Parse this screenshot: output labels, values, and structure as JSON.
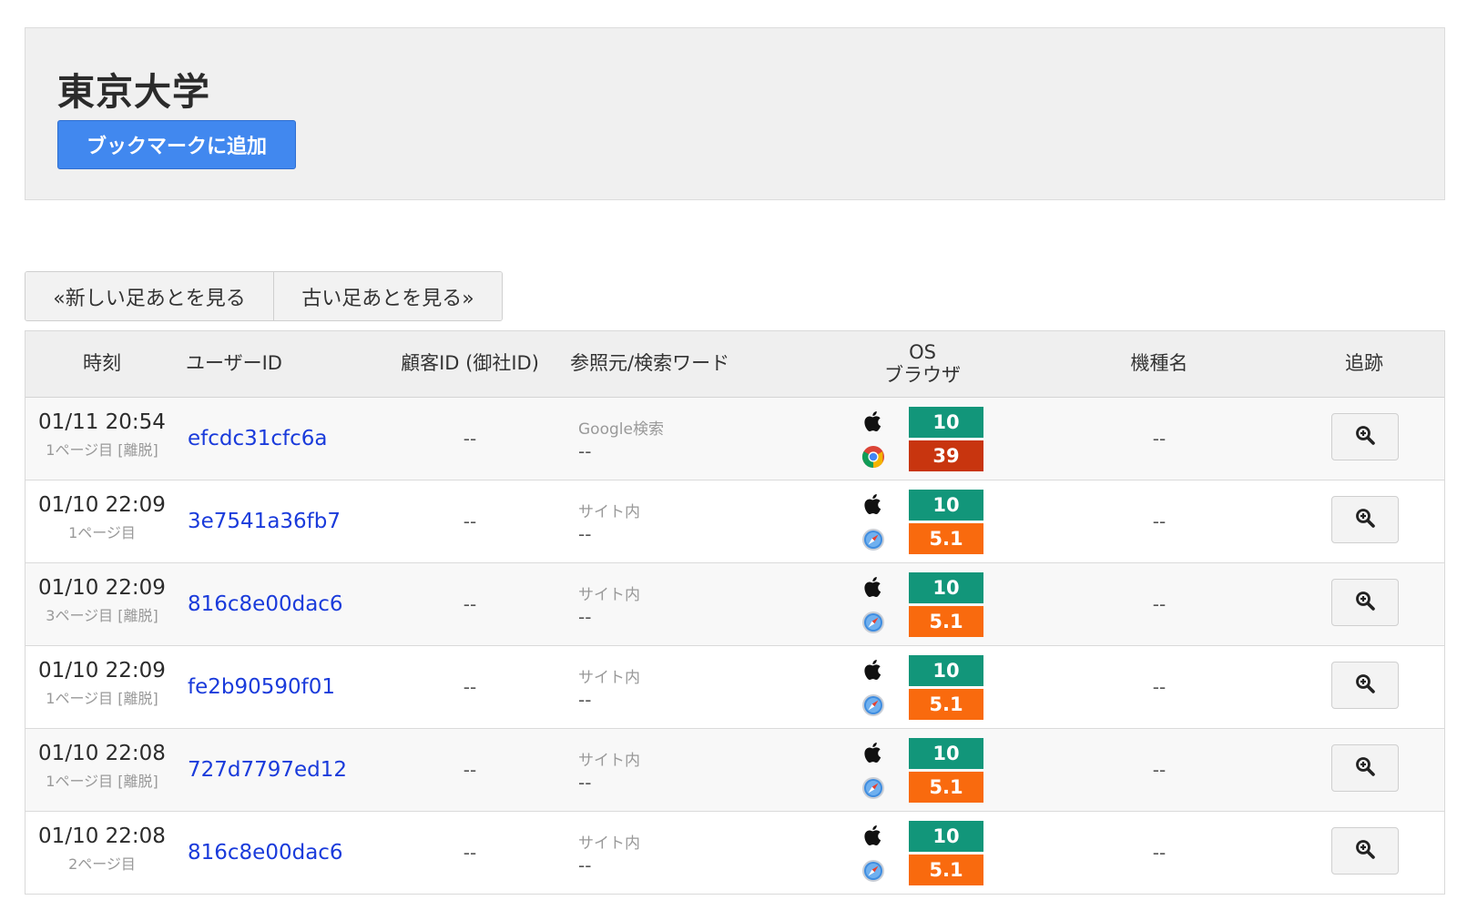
{
  "header": {
    "title": "東京大学",
    "bookmark_label": "ブックマークに追加",
    "accent_color": "#4188ef"
  },
  "pager": {
    "newer_label": "«新しい足あとを見る",
    "older_label": "古い足あとを見る»"
  },
  "table": {
    "columns": {
      "time": "時刻",
      "user_id": "ユーザーID",
      "customer_id": "顧客ID (御社ID)",
      "referrer": "参照元/検索ワード",
      "os": "OS",
      "browser": "ブラウザ",
      "model": "機種名",
      "trace": "追跡"
    },
    "rows": [
      {
        "time": "01/11 20:54",
        "page": "1ページ目 [離脱]",
        "user_id": "efcdc31cfc6a",
        "customer_id": "--",
        "ref_source": "Google検索",
        "ref_word": "--",
        "os_icon": "apple-icon",
        "os_version": "10",
        "browser_icon": "chrome-icon",
        "browser_version": "39",
        "model": "--"
      },
      {
        "time": "01/10 22:09",
        "page": "1ページ目",
        "user_id": "3e7541a36fb7",
        "customer_id": "--",
        "ref_source": "サイト内",
        "ref_word": "--",
        "os_icon": "apple-icon",
        "os_version": "10",
        "browser_icon": "safari-icon",
        "browser_version": "5.1",
        "model": "--"
      },
      {
        "time": "01/10 22:09",
        "page": "3ページ目 [離脱]",
        "user_id": "816c8e00dac6",
        "customer_id": "--",
        "ref_source": "サイト内",
        "ref_word": "--",
        "os_icon": "apple-icon",
        "os_version": "10",
        "browser_icon": "safari-icon",
        "browser_version": "5.1",
        "model": "--"
      },
      {
        "time": "01/10 22:09",
        "page": "1ページ目 [離脱]",
        "user_id": "fe2b90590f01",
        "customer_id": "--",
        "ref_source": "サイト内",
        "ref_word": "--",
        "os_icon": "apple-icon",
        "os_version": "10",
        "browser_icon": "safari-icon",
        "browser_version": "5.1",
        "model": "--"
      },
      {
        "time": "01/10 22:08",
        "page": "1ページ目 [離脱]",
        "user_id": "727d7797ed12",
        "customer_id": "--",
        "ref_source": "サイト内",
        "ref_word": "--",
        "os_icon": "apple-icon",
        "os_version": "10",
        "browser_icon": "safari-icon",
        "browser_version": "5.1",
        "model": "--"
      },
      {
        "time": "01/10 22:08",
        "page": "2ページ目",
        "user_id": "816c8e00dac6",
        "customer_id": "--",
        "ref_source": "サイト内",
        "ref_word": "--",
        "os_icon": "apple-icon",
        "os_version": "10",
        "browser_icon": "safari-icon",
        "browser_version": "5.1",
        "model": "--"
      }
    ]
  },
  "colors": {
    "os_badge": "#12967a",
    "chrome_badge": "#c8350f",
    "safari_badge": "#f96a0e",
    "link": "#1a3bdb"
  }
}
